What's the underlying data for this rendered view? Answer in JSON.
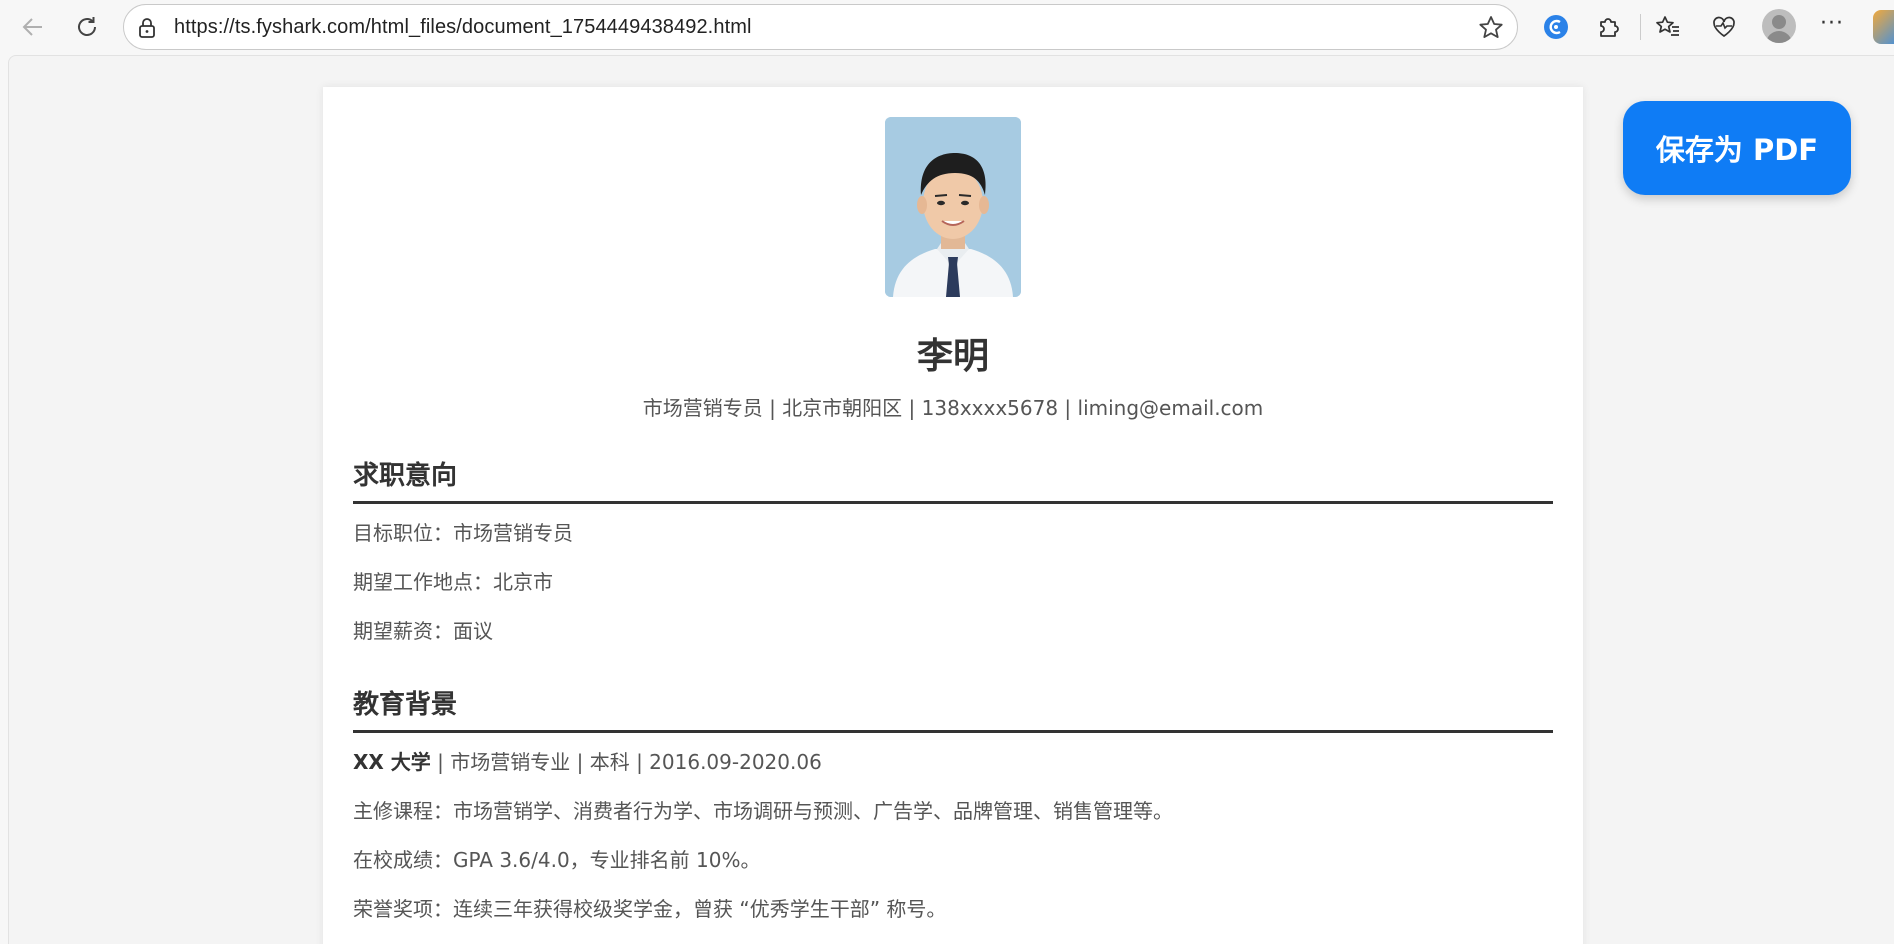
{
  "browser": {
    "url": "https://ts.fyshark.com/html_files/document_1754449438492.html"
  },
  "resume": {
    "name": "李明",
    "contact": "市场营销专员 | 北京市朝阳区 | 138xxxx5678 | liming@email.com",
    "sections": [
      {
        "title": "求职意向",
        "lines": [
          "目标职位：市场营销专员",
          "期望工作地点：北京市",
          "期望薪资：面议"
        ]
      },
      {
        "title": "教育背景",
        "school": "XX 大学",
        "school_detail": " | 市场营销专业 | 本科 | 2016.09-2020.06",
        "lines": [
          "主修课程：市场营销学、消费者行为学、市场调研与预测、广告学、品牌管理、销售管理等。",
          "在校成绩：GPA 3.6/4.0，专业排名前 10%。",
          "荣誉奖项：连续三年获得校级奖学金，曾获 “优秀学生干部” 称号。"
        ]
      }
    ]
  },
  "save_pdf_button": {
    "label": "保存为 PDF",
    "color": "#0f7cf5"
  }
}
